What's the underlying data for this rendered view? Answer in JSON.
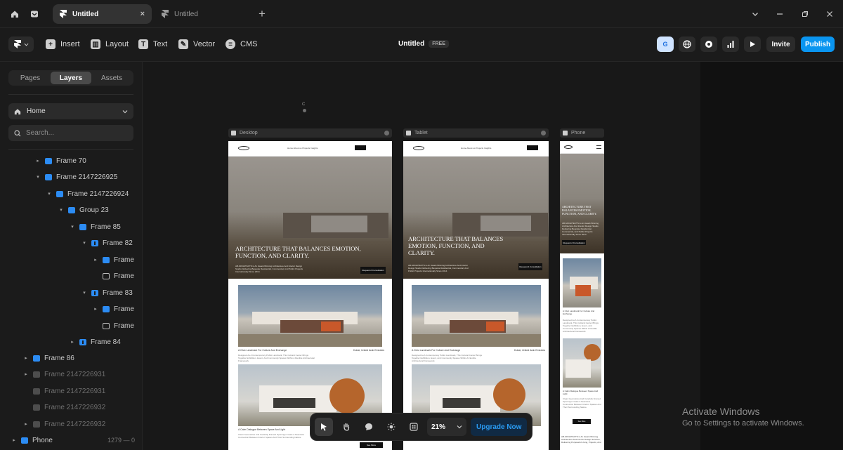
{
  "titlebar": {
    "tabs": [
      {
        "label": "Untitled",
        "active": true,
        "close": "×"
      },
      {
        "label": "Untitled",
        "active": false
      }
    ],
    "new_tab": "+"
  },
  "toolbar": {
    "tools": [
      "Insert",
      "Layout",
      "Text",
      "Vector",
      "CMS"
    ],
    "doc_title": "Untitled",
    "plan_badge": "FREE",
    "avatar_initial": "G",
    "invite_label": "Invite",
    "publish_label": "Publish"
  },
  "sidebar": {
    "tabs": [
      "Pages",
      "Layers",
      "Assets"
    ],
    "active_tab": "Layers",
    "page_selector": "Home",
    "search_placeholder": "Search...",
    "layers": [
      {
        "label": "Frame 70",
        "icon": "stack",
        "arrow": "▸"
      },
      {
        "label": "Frame 2147226925",
        "icon": "stack",
        "arrow": "▾"
      },
      {
        "label": "Frame 2147226924",
        "icon": "sq",
        "arrow": "▾"
      },
      {
        "label": "Group 23",
        "icon": "sq",
        "arrow": "▾"
      },
      {
        "label": "Frame 85",
        "icon": "stack",
        "arrow": "▾"
      },
      {
        "label": "Frame 82",
        "icon": "grid",
        "arrow": "▾"
      },
      {
        "label": "Frame",
        "icon": "stack",
        "arrow": "▸"
      },
      {
        "label": "Frame",
        "icon": "img",
        "arrow": ""
      },
      {
        "label": "Frame 83",
        "icon": "grid",
        "arrow": "▾"
      },
      {
        "label": "Frame",
        "icon": "stack",
        "arrow": "▸"
      },
      {
        "label": "Frame",
        "icon": "img",
        "arrow": ""
      },
      {
        "label": "Frame 84",
        "icon": "grid",
        "arrow": "▸"
      },
      {
        "label": "Frame 86",
        "icon": "sq",
        "arrow": "▸"
      },
      {
        "label": "Frame 2147226931",
        "icon": "dim",
        "arrow": "▸"
      },
      {
        "label": "Frame 2147226931",
        "icon": "dim",
        "arrow": ""
      },
      {
        "label": "Frame 2147226932",
        "icon": "dim",
        "arrow": ""
      },
      {
        "label": "Frame 2147226932",
        "icon": "dim",
        "arrow": "▸"
      }
    ],
    "bottom_layer": {
      "label": "Phone",
      "info": "1279 — 0"
    }
  },
  "canvas": {
    "marker": "C",
    "breakpoints": [
      "Desktop",
      "Tablet",
      "Phone"
    ],
    "site": {
      "nav_links": "Home   About us   Projects   Insights",
      "nav_cta": "Contact Us",
      "hero_title_desktop": "ARCHITECTURE THAT BALANCES EMOTION, FUNCTION, AND CLARITY.",
      "hero_title_tablet": "ARCHITECTURE THAT BALANCES EMOTION, FUNCTION, AND CLARITY.",
      "hero_title_phone": "ARCHITECTURE THAT BALANCES EMOTION, FUNCTION, AND CLARITY.",
      "hero_sub": "AB ARCHITECTS is An Award-Winning Architecture And Interior Design Studio Delivering Bespoke Residential, Commercial, And Public Projects Internationally Since 2014.",
      "hero_cta": "Request A Consultation",
      "project1_title": "A Civic Landmark For Culture And Exchange",
      "project1_location": "Dubai, United Arab Emirates",
      "project1_desc": "Designed As A Contemporary Public Landmark, This Cultural Center Brings Together Exhibition, Event, And Community Spaces Within A Flexible Architectural Framework.",
      "project2_title": "A Calm Dialogue Between Space And Light",
      "project2_desc": "Clean Geometries And Carefully Framed Openings Create A Seamless Connection Between Interior Spaces And Their Surrounding Nature.",
      "see_more": "See More",
      "phone_text": "AB ARCHITECTS is An Award-Winning Architecture And Interior Design Services, Delivering Purposeful Living, Projects, And"
    }
  },
  "dock": {
    "zoom": "21%",
    "upgrade_label": "Upgrade Now"
  },
  "watermark": {
    "line1": "Activate Windows",
    "line2": "Go to Settings to activate Windows."
  }
}
